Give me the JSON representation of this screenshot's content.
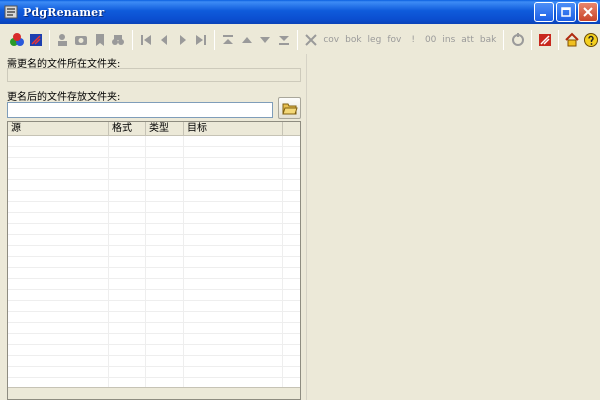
{
  "window": {
    "title": "PdgRenamer"
  },
  "toolbar": {
    "text_buttons": [
      "cov",
      "bok",
      "leg",
      "fov",
      "!",
      "00",
      "ins",
      "att",
      "bak"
    ]
  },
  "labels": {
    "source_folder": "需更名的文件所在文件夹:",
    "target_folder": "更名后的文件存放文件夹:"
  },
  "fields": {
    "source_folder_value": "",
    "target_folder_value": ""
  },
  "list": {
    "columns": [
      "源",
      "格式",
      "类型",
      "目标"
    ]
  },
  "colors": {
    "accent": "#0b4ed0",
    "face": "#ece9d8"
  }
}
